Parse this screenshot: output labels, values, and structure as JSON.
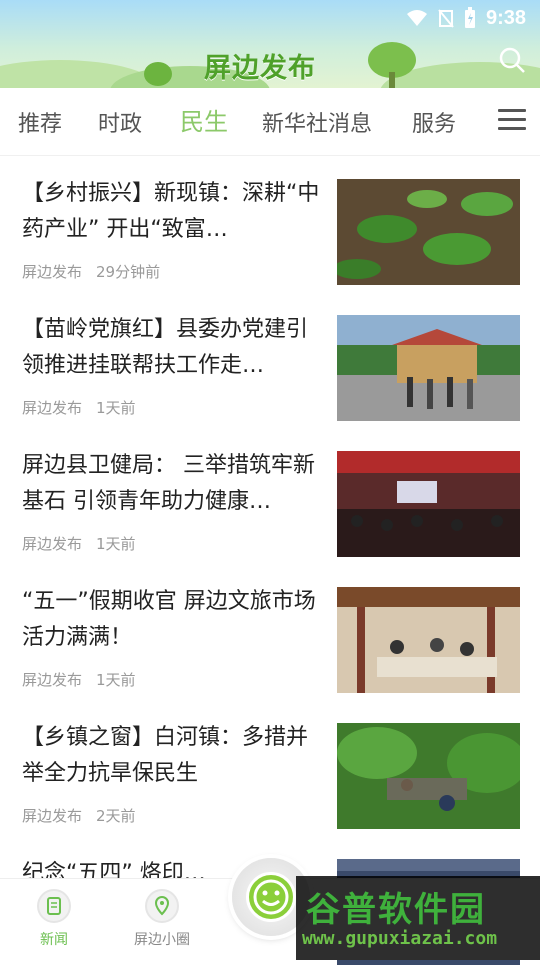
{
  "status_bar": {
    "time": "9:38"
  },
  "header": {
    "title": "屏边发布",
    "search_icon": "search-icon"
  },
  "tabs": [
    {
      "label": "推荐"
    },
    {
      "label": "时政"
    },
    {
      "label": "民生"
    },
    {
      "label": "新华社消息"
    },
    {
      "label": "服务"
    }
  ],
  "active_tab": "民生",
  "articles": [
    {
      "title": "【乡村振兴】新现镇：深耕“中药产业” 开出“致富…",
      "source": "屏边发布",
      "time": "29分钟前"
    },
    {
      "title": "【苗岭党旗红】县委办党建引领推进挂联帮扶工作走…",
      "source": "屏边发布",
      "time": "1天前"
    },
    {
      "title": "屏边县卫健局： 三举措筑牢新基石 引领青年助力健康…",
      "source": "屏边发布",
      "time": "1天前"
    },
    {
      "title": "“五一”假期收官 屏边文旅市场活力满满！",
      "source": "屏边发布",
      "time": "1天前"
    },
    {
      "title": "【乡镇之窗】白河镇：多措并举全力抗旱保民生",
      "source": "屏边发布",
      "time": "2天前"
    },
    {
      "title": "纪念“五四” 烙印…",
      "source": "",
      "time": ""
    }
  ],
  "bottom_nav": [
    {
      "label": "新闻",
      "icon": "news-icon"
    },
    {
      "label": "屏边小圈",
      "icon": "location-icon"
    }
  ],
  "watermark": {
    "title": "谷普软件园",
    "url": "www.gupuxiazai.com"
  },
  "colors": {
    "accent": "#8cc96a",
    "brand_green": "#4fa12a"
  }
}
